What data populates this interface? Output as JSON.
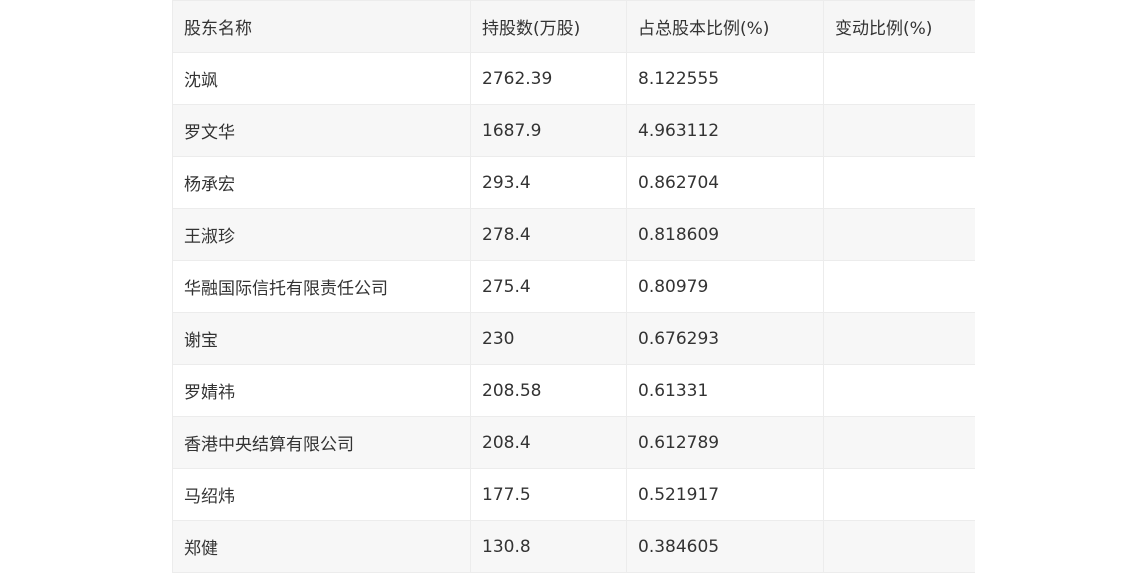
{
  "table": {
    "headers": [
      "股东名称",
      "持股数(万股)",
      "占总股本比例(%)",
      "变动比例(%)"
    ],
    "rows": [
      {
        "name": "沈飒",
        "shares": "2762.39",
        "ratio": "8.122555",
        "change": ""
      },
      {
        "name": "罗文华",
        "shares": "1687.9",
        "ratio": "4.963112",
        "change": ""
      },
      {
        "name": "杨承宏",
        "shares": "293.4",
        "ratio": "0.862704",
        "change": ""
      },
      {
        "name": "王淑珍",
        "shares": "278.4",
        "ratio": "0.818609",
        "change": ""
      },
      {
        "name": "华融国际信托有限责任公司",
        "shares": "275.4",
        "ratio": "0.80979",
        "change": ""
      },
      {
        "name": "谢宝",
        "shares": "230",
        "ratio": "0.676293",
        "change": ""
      },
      {
        "name": "罗婧祎",
        "shares": "208.58",
        "ratio": "0.61331",
        "change": ""
      },
      {
        "name": "香港中央结算有限公司",
        "shares": "208.4",
        "ratio": "0.612789",
        "change": ""
      },
      {
        "name": "马绍炜",
        "shares": "177.5",
        "ratio": "0.521917",
        "change": ""
      },
      {
        "name": "郑健",
        "shares": "130.8",
        "ratio": "0.384605",
        "change": ""
      }
    ]
  }
}
